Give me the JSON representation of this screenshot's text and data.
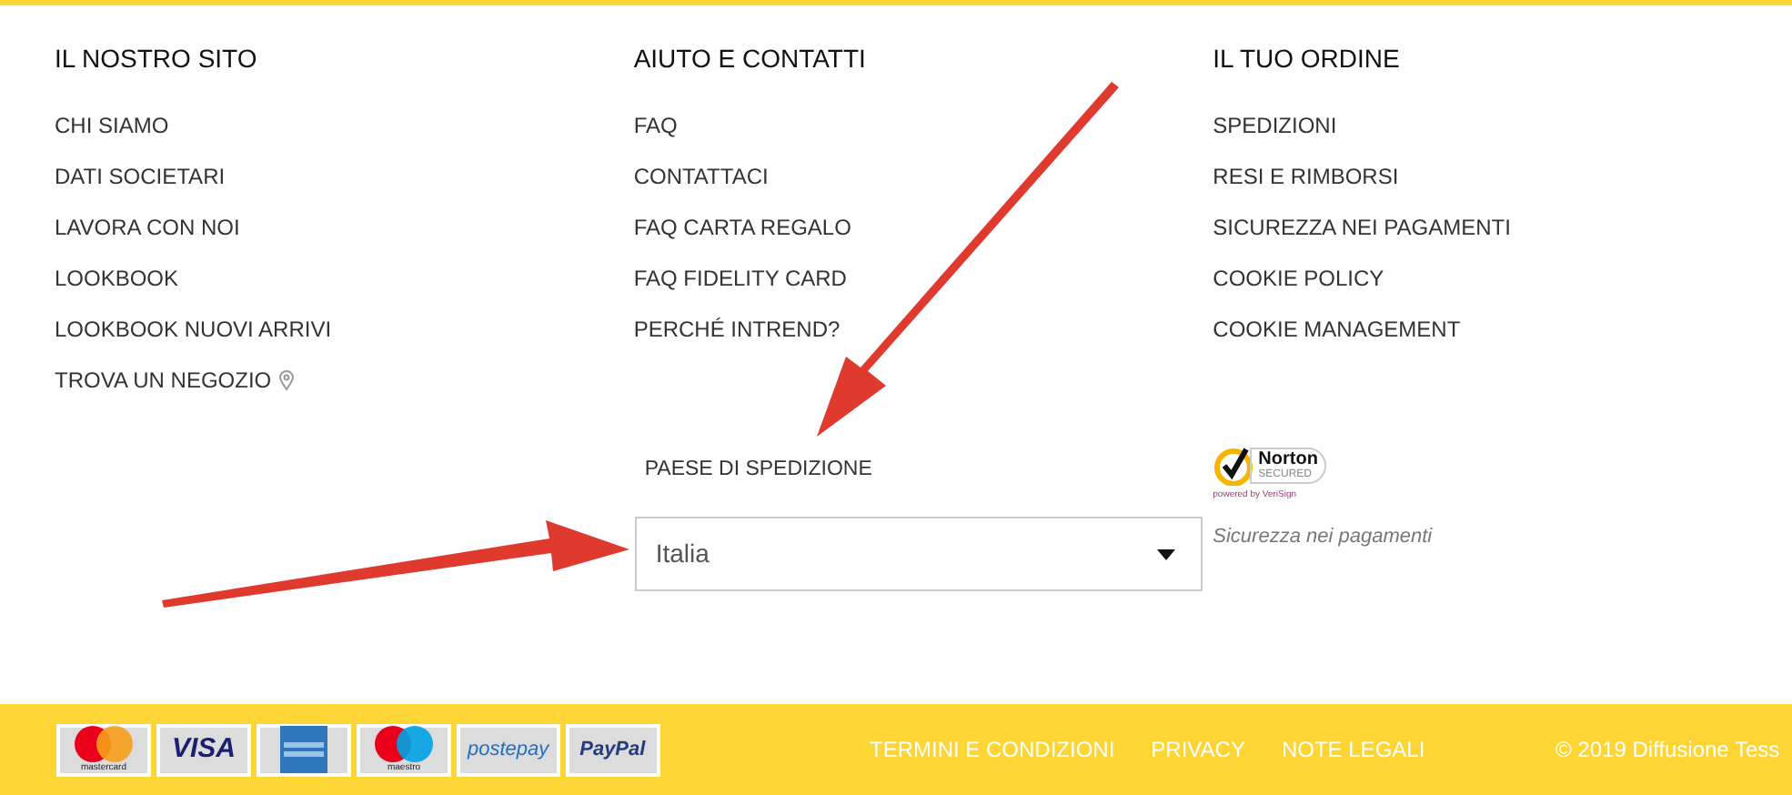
{
  "columns": [
    {
      "title": "IL NOSTRO SITO",
      "links": [
        {
          "label": "CHI SIAMO"
        },
        {
          "label": "DATI SOCIETARI"
        },
        {
          "label": "LAVORA CON NOI"
        },
        {
          "label": "LOOKBOOK"
        },
        {
          "label": "LOOKBOOK NUOVI ARRIVI"
        },
        {
          "label": "TROVA UN NEGOZIO",
          "kind": "pin"
        }
      ]
    },
    {
      "title": "AIUTO E CONTATTI",
      "links": [
        {
          "label": "FAQ"
        },
        {
          "label": "CONTATTACI"
        },
        {
          "label": "FAQ CARTA REGALO"
        },
        {
          "label": "FAQ FIDELITY CARD"
        },
        {
          "label": "PERCHÉ INTREND?"
        }
      ]
    },
    {
      "title": "IL TUO ORDINE",
      "links": [
        {
          "label": "SPEDIZIONI"
        },
        {
          "label": "RESI E RIMBORSI"
        },
        {
          "label": "SICUREZZA NEI PAGAMENTI"
        },
        {
          "label": "COOKIE POLICY"
        },
        {
          "label": "COOKIE MANAGEMENT"
        }
      ]
    }
  ],
  "shipping": {
    "label": "PAESE DI SPEDIZIONE",
    "value": "Italia"
  },
  "norton": {
    "name": "Norton",
    "secured": "SECURED",
    "powered": "powered by VeriSign",
    "caption": "Sicurezza nei pagamenti"
  },
  "payments": [
    {
      "kind": "mastercard",
      "text": "mastercard"
    },
    {
      "kind": "visa",
      "text": "VISA"
    },
    {
      "kind": "amex"
    },
    {
      "kind": "maestro",
      "text": "maestro"
    },
    {
      "kind": "postepay",
      "text": "postepay"
    },
    {
      "kind": "paypal",
      "text": "PayPal"
    }
  ],
  "footer_links": [
    "TERMINI E CONDIZIONI",
    "PRIVACY",
    "NOTE LEGALI"
  ],
  "copyright": "© 2019 Diffusione Tess"
}
